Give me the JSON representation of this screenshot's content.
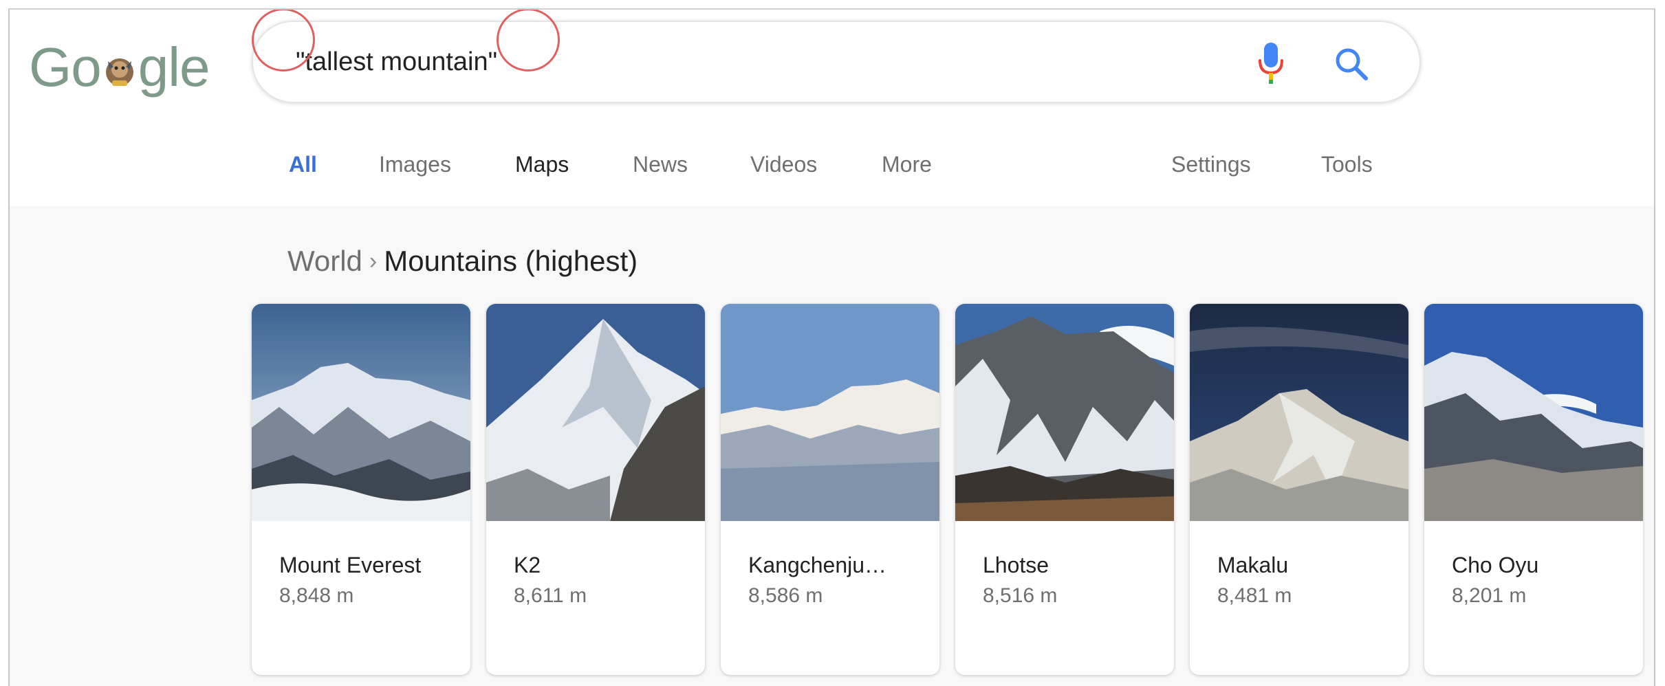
{
  "logo": {
    "text_left": "Go",
    "text_right": "gle"
  },
  "search": {
    "query": "\"tallest mountain\""
  },
  "tabs": {
    "all": "All",
    "images": "Images",
    "maps": "Maps",
    "news": "News",
    "videos": "Videos",
    "more": "More",
    "settings": "Settings",
    "tools": "Tools"
  },
  "breadcrumb": {
    "parent": "World",
    "separator": "›",
    "current": "Mountains (highest)"
  },
  "mountains": [
    {
      "name": "Mount Everest",
      "height": "8,848 m"
    },
    {
      "name": "K2",
      "height": "8,611 m"
    },
    {
      "name": "Kangchenju…",
      "height": "8,586 m"
    },
    {
      "name": "Lhotse",
      "height": "8,516 m"
    },
    {
      "name": "Makalu",
      "height": "8,481 m"
    },
    {
      "name": "Cho Oyu",
      "height": "8,201 m"
    }
  ],
  "colors": {
    "accent_blue": "#3d6ed6",
    "logo": "#7e9a8a",
    "annotation_red": "#e06060"
  }
}
